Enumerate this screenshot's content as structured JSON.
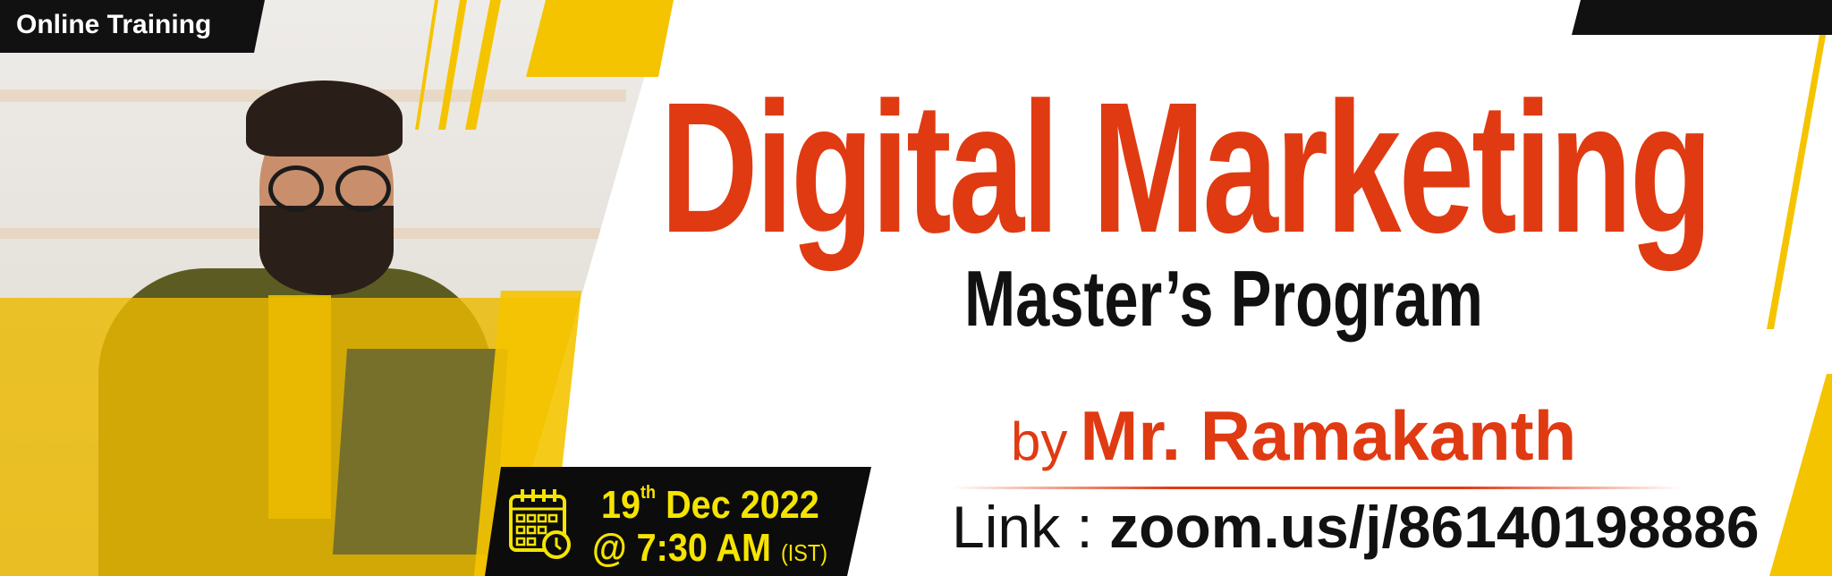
{
  "badge": {
    "label": "Online Training"
  },
  "title": "Digital Marketing",
  "subtitle": "Master’s Program",
  "presenter": {
    "prefix": "by",
    "name": "Mr. Ramakanth"
  },
  "link": {
    "label": "Link :",
    "url": "zoom.us/j/86140198886"
  },
  "event": {
    "day": "19",
    "day_suffix": "th",
    "month_year": "Dec 2022",
    "time": "@ 7:30 AM",
    "timezone": "(IST)",
    "icon": "calendar-clock-icon"
  },
  "colors": {
    "accent_red": "#e03a12",
    "accent_yellow": "#f5c400",
    "dark": "#111111"
  }
}
